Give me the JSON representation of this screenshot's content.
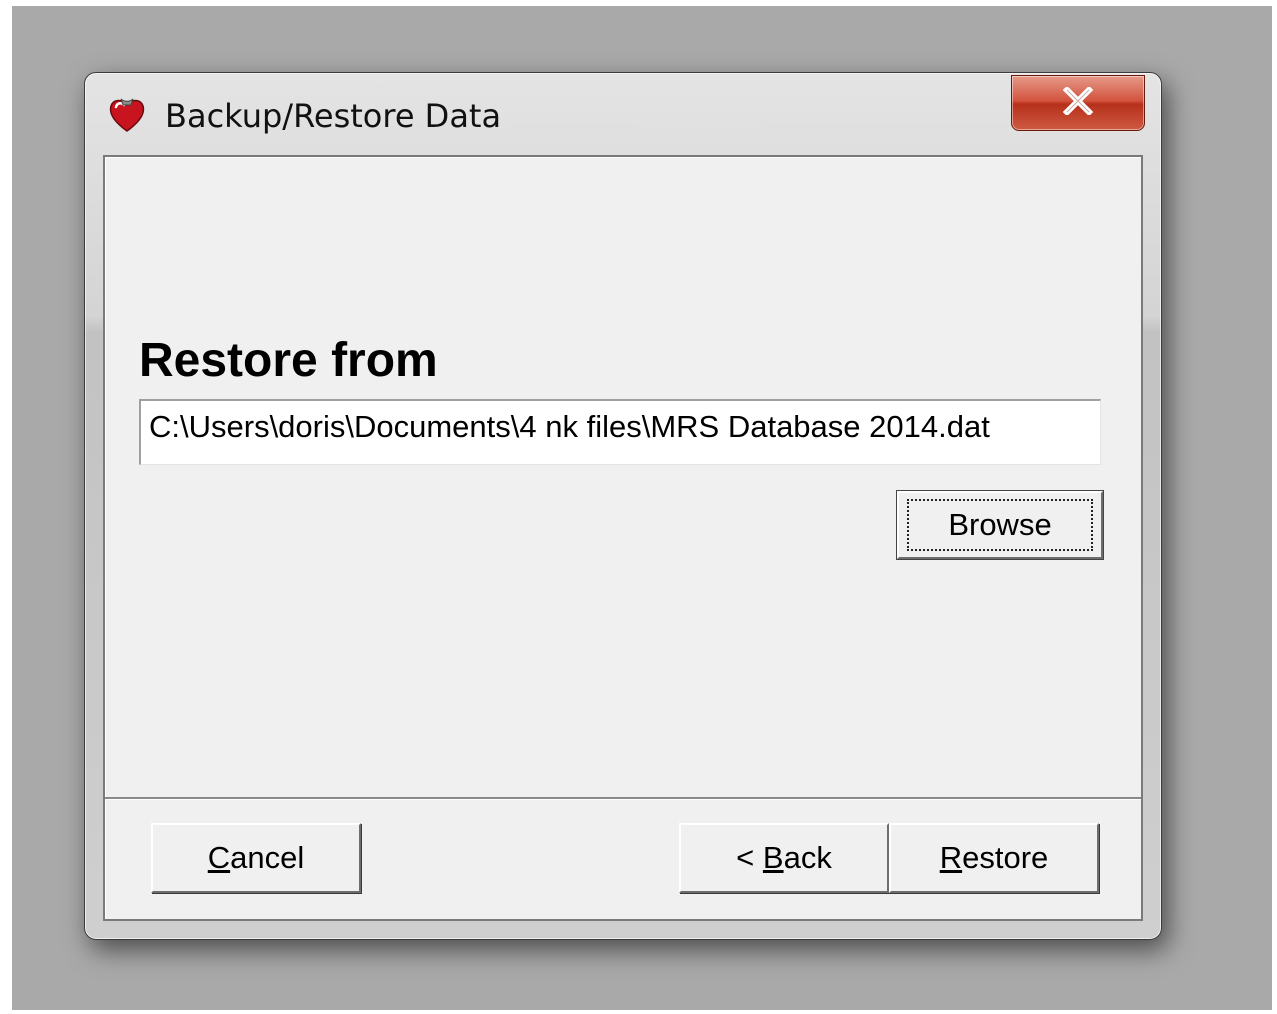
{
  "window": {
    "title": "Backup/Restore Data",
    "app_icon": "heart-shield-icon",
    "close_icon": "close-icon"
  },
  "main": {
    "heading": "Restore from",
    "path_value": "C:\\Users\\doris\\Documents\\4 nk files\\MRS Database 2014.dat",
    "browse_label": "Browse"
  },
  "footer": {
    "cancel": {
      "mnemonic": "C",
      "rest": "ancel"
    },
    "back": {
      "prefix": "< ",
      "mnemonic": "B",
      "rest": "ack"
    },
    "restore": {
      "mnemonic": "R",
      "rest": "estore"
    }
  },
  "colors": {
    "close_button": "#c8412a",
    "dialog_background": "#f0f0f0",
    "desktop_background": "#a9a9a9"
  }
}
